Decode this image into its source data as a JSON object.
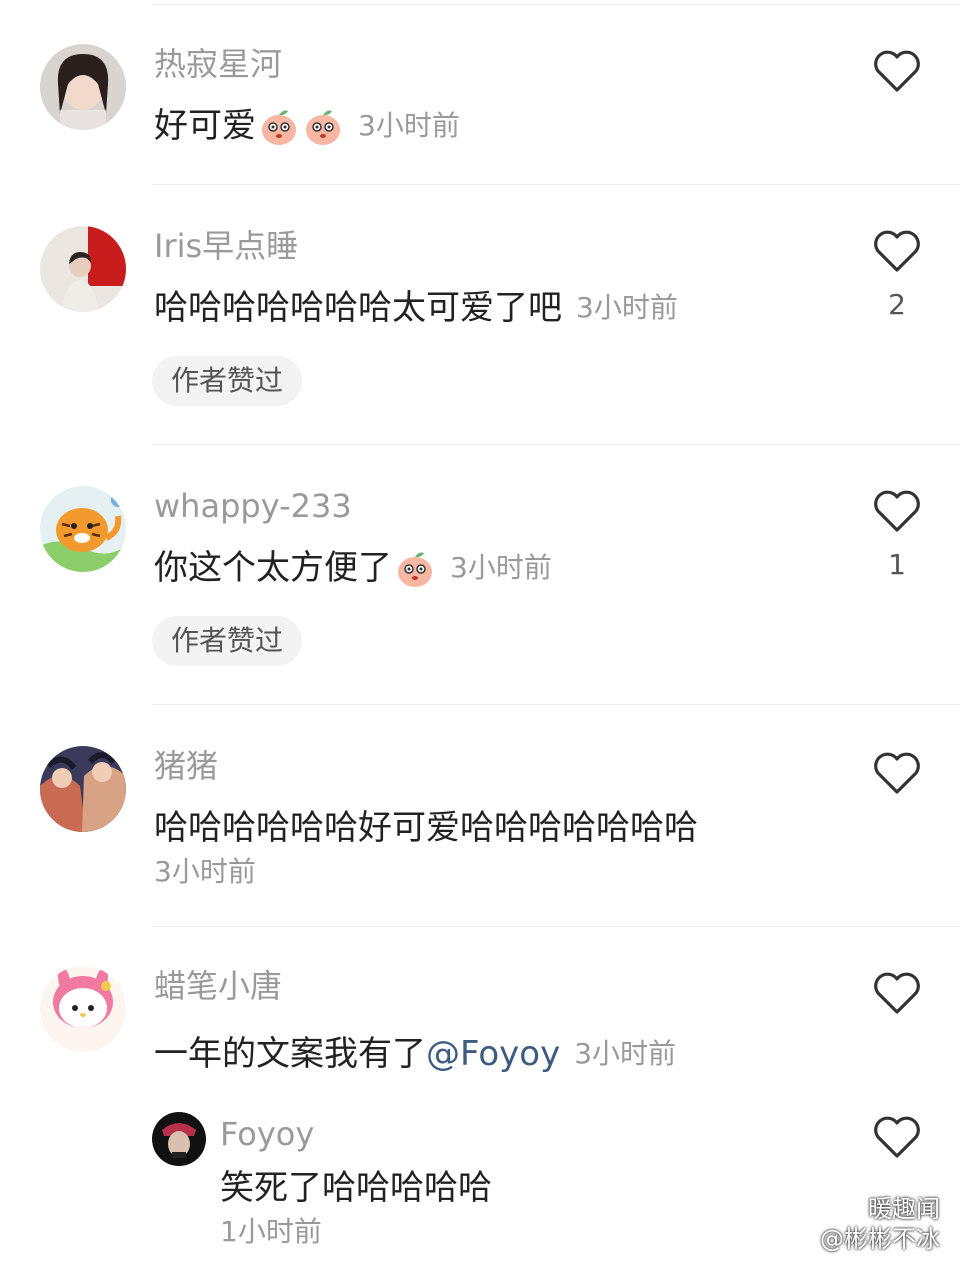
{
  "comments": [
    {
      "username": "热寂星河",
      "text": "好可爱",
      "emojis": [
        "peach-emoji",
        "peach-emoji"
      ],
      "time": "3小时前",
      "likes": ""
    },
    {
      "username": "Iris早点睡",
      "text": "哈哈哈哈哈哈哈太可爱了吧",
      "time": "3小时前",
      "likes": "2",
      "badge": "作者赞过"
    },
    {
      "username": "whappy-233",
      "text": "你这个太方便了",
      "emojis": [
        "peach-emoji"
      ],
      "time": "3小时前",
      "likes": "1",
      "badge": "作者赞过"
    },
    {
      "username": "猪猪",
      "text": "哈哈哈哈哈哈好可爱哈哈哈哈哈哈哈",
      "time": "3小时前",
      "likes": ""
    },
    {
      "username": "蜡笔小唐",
      "text": "一年的文案我有了",
      "mention": "@Foyoy",
      "time": "3小时前",
      "likes": ""
    }
  ],
  "reply": {
    "username": "Foyoy",
    "text": "笑死了哈哈哈哈哈",
    "time": "1小时前"
  },
  "icons": {
    "like": "heart-outline-icon",
    "emoji": "peach-emoji"
  },
  "watermark": {
    "line1": "暖趣闻",
    "line2": "@彬彬不冰"
  },
  "colors": {
    "username": "#9a9a9a",
    "text": "#222222",
    "time": "#9a9a9a",
    "mention": "#3d5a80",
    "badge_bg": "#f3f3f3"
  }
}
